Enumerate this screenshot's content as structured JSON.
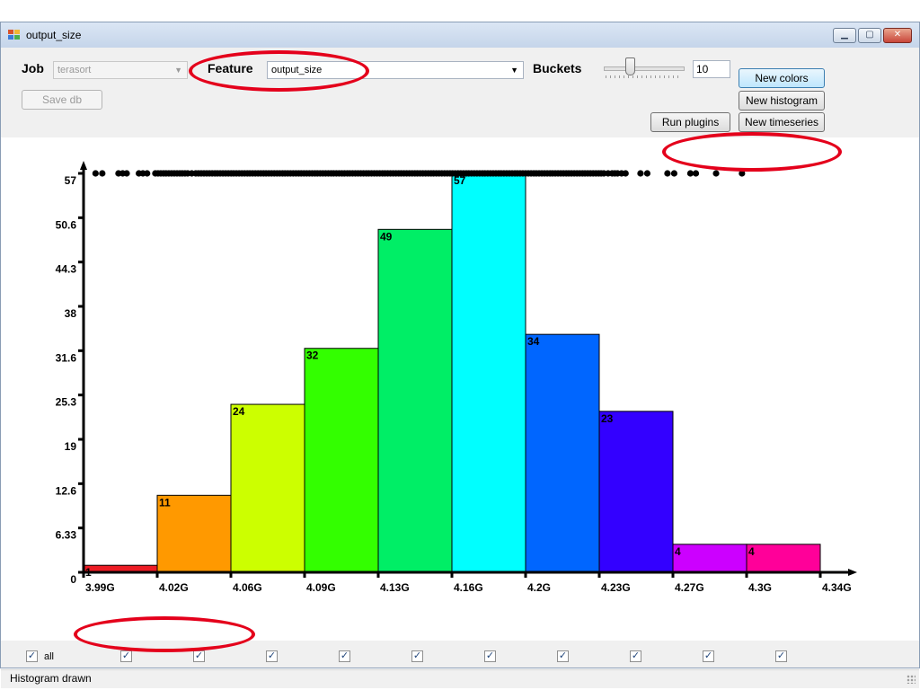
{
  "window": {
    "title": "output_size",
    "controls": [
      "minimize",
      "maximize",
      "close"
    ]
  },
  "toolbar": {
    "job_label": "Job",
    "job_value": "terasort",
    "save_db_label": "Save db",
    "feature_label": "Feature",
    "feature_value": "output_size",
    "buckets_label": "Buckets",
    "buckets_value": "10",
    "buckets_slider_level": 0.3,
    "new_colors_label": "New colors",
    "new_histogram_label": "New histogram",
    "run_plugins_label": "Run plugins",
    "new_timeseries_label": "New timeseries"
  },
  "chart_data": {
    "type": "bar",
    "title": "",
    "xlabel": "",
    "ylabel": "",
    "categories": [
      "3.99G",
      "4.02G",
      "4.06G",
      "4.09G",
      "4.13G",
      "4.16G",
      "4.2G",
      "4.23G",
      "4.27G",
      "4.3G"
    ],
    "x_ticks": [
      "3.99G",
      "4.02G",
      "4.06G",
      "4.09G",
      "4.13G",
      "4.16G",
      "4.2G",
      "4.23G",
      "4.27G",
      "4.3G",
      "4.34G"
    ],
    "y_ticks": [
      "0",
      "6.33",
      "12.6",
      "19",
      "25.3",
      "31.6",
      "38",
      "44.3",
      "50.6",
      "57"
    ],
    "ylim": [
      0,
      57
    ],
    "values": [
      1,
      11,
      24,
      32,
      49,
      57,
      34,
      23,
      4,
      4
    ],
    "value_labels": [
      "1",
      "11",
      "24",
      "32",
      "49",
      "57",
      "34",
      "23",
      "4",
      "4"
    ],
    "colors": [
      "#ec1c24",
      "#ff9900",
      "#ccff00",
      "#33ff00",
      "#00ee66",
      "#00ffff",
      "#0066ff",
      "#3300ff",
      "#cc00ff",
      "#ff0099"
    ],
    "grid": false,
    "legend": "none",
    "rug_points": [
      3.9957,
      3.9989,
      4.0066,
      4.0086,
      4.0105,
      4.0163,
      4.0182,
      4.0202,
      4.0241,
      4.0254,
      4.0267,
      4.028,
      4.0292,
      4.0305,
      4.0318,
      4.0331,
      4.0344,
      4.0357,
      4.0369,
      4.0382,
      4.0395,
      4.0414,
      4.0433,
      4.0446,
      4.0459,
      4.0472,
      4.0485,
      4.0498,
      4.0511,
      4.0524,
      4.0536,
      4.0549,
      4.0562,
      4.0575,
      4.0588,
      4.0601,
      4.0613,
      4.0626,
      4.0639,
      4.0652,
      4.0665,
      4.0678,
      4.069,
      4.0703,
      4.0716,
      4.0729,
      4.0742,
      4.0755,
      4.0767,
      4.078,
      4.0793,
      4.0806,
      4.0819,
      4.0832,
      4.0845,
      4.0857,
      4.087,
      4.0883,
      4.0896,
      4.0909,
      4.0922,
      4.0934,
      4.0947,
      4.096,
      4.0973,
      4.0986,
      4.0999,
      4.1011,
      4.1024,
      4.1037,
      4.105,
      4.1063,
      4.1076,
      4.1088,
      4.1101,
      4.1114,
      4.1127,
      4.114,
      4.1153,
      4.1165,
      4.1178,
      4.1191,
      4.1204,
      4.1217,
      4.123,
      4.1243,
      4.1255,
      4.1268,
      4.1281,
      4.1294,
      4.1307,
      4.132,
      4.1332,
      4.1345,
      4.1358,
      4.1371,
      4.1384,
      4.1397,
      4.1409,
      4.1422,
      4.1435,
      4.1448,
      4.1461,
      4.1474,
      4.1486,
      4.1499,
      4.1512,
      4.1525,
      4.1538,
      4.1551,
      4.1563,
      4.1576,
      4.1589,
      4.1602,
      4.1615,
      4.1628,
      4.1641,
      4.1653,
      4.1666,
      4.1679,
      4.1692,
      4.1705,
      4.1718,
      4.173,
      4.1743,
      4.1756,
      4.1769,
      4.1782,
      4.1795,
      4.1807,
      4.182,
      4.1833,
      4.1846,
      4.1859,
      4.1872,
      4.1884,
      4.1897,
      4.191,
      4.1923,
      4.1936,
      4.1949,
      4.1961,
      4.1974,
      4.1987,
      4.2,
      4.2013,
      4.2026,
      4.2039,
      4.2051,
      4.2064,
      4.2077,
      4.209,
      4.2103,
      4.2116,
      4.2128,
      4.2141,
      4.2154,
      4.2167,
      4.218,
      4.2193,
      4.2205,
      4.2218,
      4.2231,
      4.2244,
      4.2257,
      4.227,
      4.2282,
      4.2295,
      4.2308,
      4.2321,
      4.2334,
      4.2347,
      4.2359,
      4.2372,
      4.2392,
      4.2411,
      4.2424,
      4.2437,
      4.2456,
      4.2475,
      4.2546,
      4.2578,
      4.2674,
      4.2706,
      4.2783,
      4.2809,
      4.2905,
      4.3028
    ]
  },
  "checkboxes": {
    "all_label": "all"
  },
  "status": {
    "text": "Histogram drawn"
  }
}
